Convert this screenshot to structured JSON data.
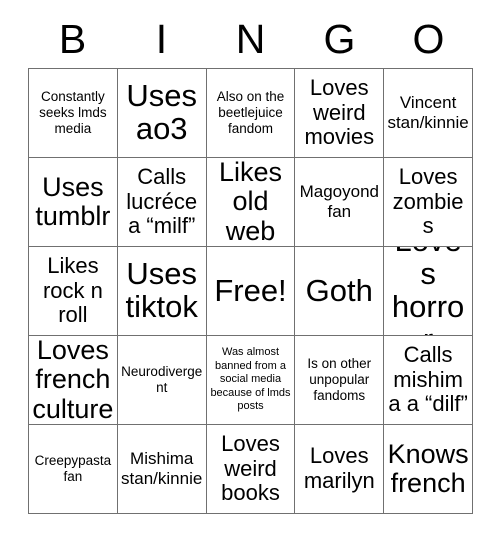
{
  "card": {
    "header_letters": [
      "B",
      "I",
      "N",
      "G",
      "O"
    ],
    "free_space_label": "Free!",
    "rows": [
      [
        {
          "text": "Constantly seeks lmds media",
          "size": "sm"
        },
        {
          "text": "Uses ao3",
          "size": "xxl"
        },
        {
          "text": "Also on the beetlejuice fandom",
          "size": "sm"
        },
        {
          "text": "Loves weird movies",
          "size": "lg"
        },
        {
          "text": "Vincent stan/kinnie",
          "size": "md"
        }
      ],
      [
        {
          "text": "Uses tumblr",
          "size": "xl"
        },
        {
          "text": "Calls lucréce a “milf”",
          "size": "lg"
        },
        {
          "text": "Likes old web",
          "size": "xl"
        },
        {
          "text": "Magoyond fan",
          "size": "md"
        },
        {
          "text": "Loves zombies",
          "size": "lg"
        }
      ],
      [
        {
          "text": "Likes rock n roll",
          "size": "lg"
        },
        {
          "text": "Uses tiktok",
          "size": "xxl"
        },
        {
          "text": "Free!",
          "size": "xxl"
        },
        {
          "text": "Goth",
          "size": "xxl"
        },
        {
          "text": "Loves horror",
          "size": "xxl"
        }
      ],
      [
        {
          "text": "Loves french culture",
          "size": "xl"
        },
        {
          "text": "Neurodivergent",
          "size": "sm"
        },
        {
          "text": "Was almost banned from a social media because of lmds posts",
          "size": "xs"
        },
        {
          "text": "Is on other unpopular fandoms",
          "size": "sm"
        },
        {
          "text": "Calls mishima a “dilf”",
          "size": "lg"
        }
      ],
      [
        {
          "text": "Creepypasta fan",
          "size": "sm"
        },
        {
          "text": "Mishima stan/kinnie",
          "size": "md"
        },
        {
          "text": "Loves weird books",
          "size": "lg"
        },
        {
          "text": "Loves marilyn",
          "size": "lg"
        },
        {
          "text": "Knows french",
          "size": "xl"
        }
      ]
    ]
  }
}
